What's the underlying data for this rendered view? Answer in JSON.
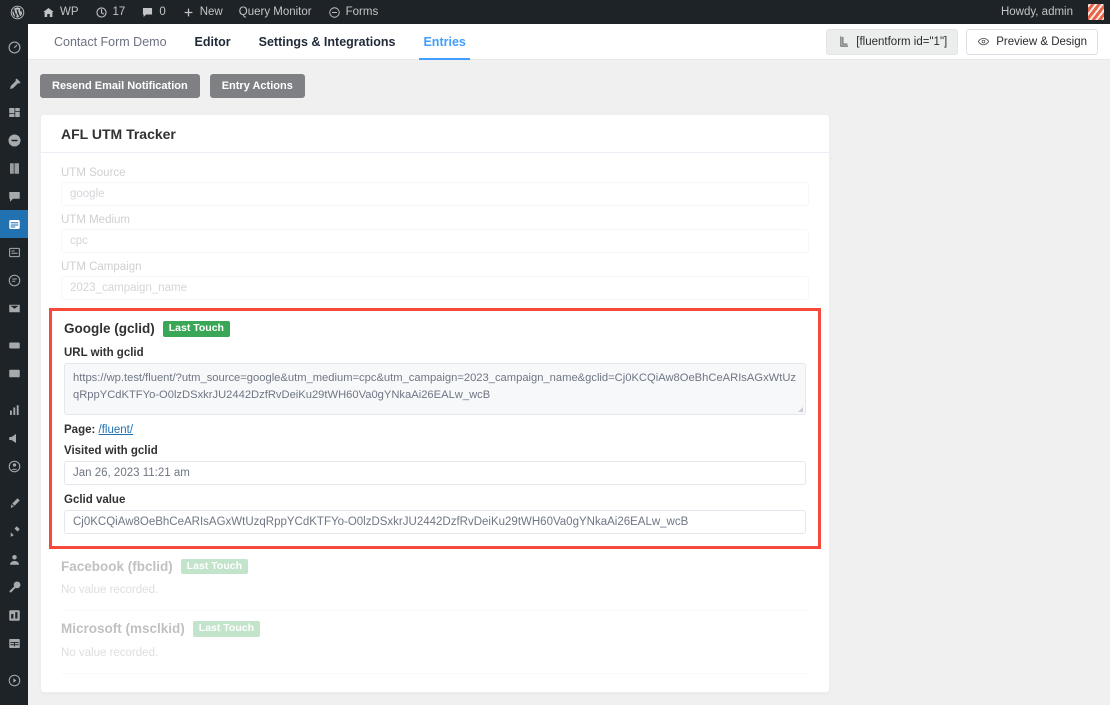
{
  "adminbar": {
    "logo_icon": "wordpress-logo-icon",
    "items": [
      {
        "icon": "home-icon",
        "label": "WP"
      },
      {
        "icon": "updates-icon",
        "label": "17"
      },
      {
        "icon": "comment-icon",
        "label": "0"
      },
      {
        "icon": "plus-icon",
        "label": "New"
      },
      {
        "icon": "",
        "label": "Query Monitor"
      },
      {
        "icon": "fluentforms-icon",
        "label": "Forms"
      }
    ],
    "howdy": "Howdy, admin",
    "avatar_icon": "user-avatar"
  },
  "sidebar": {
    "items": [
      {
        "icon": "dashboard-icon",
        "active": false
      },
      {
        "icon": "pin-posts-icon",
        "active": false
      },
      {
        "icon": "media-icon",
        "active": false
      },
      {
        "icon": "pages-icon",
        "active": false
      },
      {
        "icon": "book-icon",
        "active": false
      },
      {
        "icon": "comments-icon",
        "active": false
      },
      {
        "icon": "fluentforms-icon",
        "active": true
      },
      {
        "icon": "forms-list-icon",
        "active": false
      },
      {
        "icon": "entries-icon",
        "active": false
      },
      {
        "icon": "mail-icon",
        "active": false
      },
      {
        "icon": "seo-icon",
        "active": false
      },
      {
        "icon": "appearance-icon",
        "active": false
      },
      {
        "icon": "analytics-icon",
        "active": false
      },
      {
        "icon": "marketing-icon",
        "active": false
      },
      {
        "icon": "users-circle-icon",
        "active": false
      },
      {
        "icon": "brush-icon",
        "active": false
      },
      {
        "icon": "plugins-icon",
        "active": false
      },
      {
        "icon": "user-icon",
        "active": false
      },
      {
        "icon": "tools-icon",
        "active": false
      },
      {
        "icon": "settings-grid-icon",
        "active": false
      },
      {
        "icon": "table-icon",
        "active": false
      },
      {
        "icon": "collapse-icon",
        "active": false
      }
    ]
  },
  "header": {
    "tabs": [
      {
        "label": "Contact Form Demo",
        "state": "muted"
      },
      {
        "label": "Editor",
        "state": "bold"
      },
      {
        "label": "Settings & Integrations",
        "state": "bold"
      },
      {
        "label": "Entries",
        "state": "active"
      }
    ],
    "shortcode_button": {
      "label": "[fluentform id=\"1\"]",
      "icon": "shortcode-icon"
    },
    "preview_button": {
      "label": "Preview & Design",
      "icon": "eye-icon"
    }
  },
  "actions": {
    "resend_label": "Resend Email Notification",
    "entry_actions_label": "Entry Actions"
  },
  "card": {
    "title": "AFL UTM Tracker",
    "utm_fields": [
      {
        "label": "UTM Source",
        "value": "google"
      },
      {
        "label": "UTM Medium",
        "value": "cpc"
      },
      {
        "label": "UTM Campaign",
        "value": "2023_campaign_name"
      }
    ],
    "gclid": {
      "title": "Google (gclid)",
      "badge": "Last Touch",
      "url_label": "URL with gclid",
      "url_value": "https://wp.test/fluent/?utm_source=google&utm_medium=cpc&utm_campaign=2023_campaign_name&gclid=Cj0KCQiAw8OeBhCeARIsAGxWtUzqRppYCdKTFYo-O0lzDSxkrJU2442DzfRvDeiKu29tWH60Va0gYNkaAi26EALw_wcB",
      "page_prefix": "Page:",
      "page_link": "/fluent/",
      "visited_label": "Visited with gclid",
      "visited_value": "Jan 26, 2023 11:21 am",
      "value_label": "Gclid value",
      "value_value": "Cj0KCQiAw8OeBhCeARIsAGxWtUzqRppYCdKTFYo-O0lzDSxkrJU2442DzfRvDeiKu29tWH60Va0gYNkaAi26EALw_wcB"
    },
    "facebook": {
      "title": "Facebook (fbclid)",
      "badge": "Last Touch",
      "empty": "No value recorded."
    },
    "microsoft": {
      "title": "Microsoft (msclkid)",
      "badge": "Last Touch",
      "empty": "No value recorded."
    }
  },
  "colors": {
    "admin_dark": "#1d2327",
    "accent_blue": "#409eff",
    "wp_blue": "#2271b1",
    "badge_green": "#3aa757",
    "highlight_red": "#f7493b",
    "page_bg": "#f0f0f1"
  }
}
